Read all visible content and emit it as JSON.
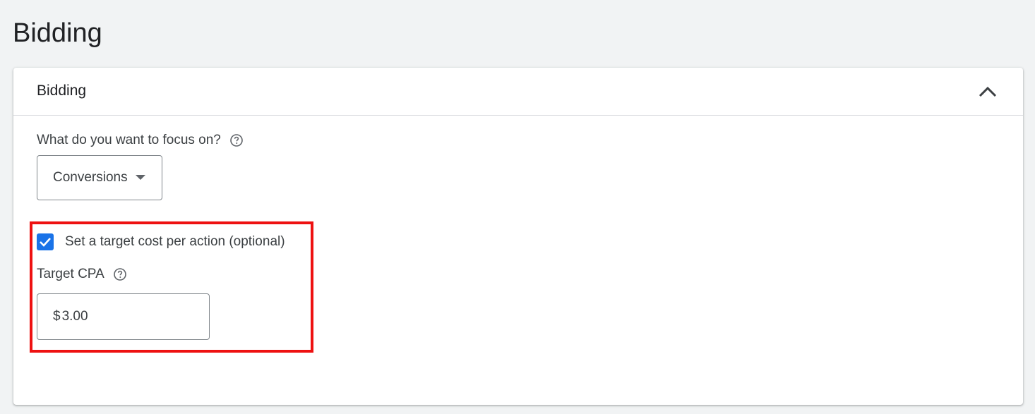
{
  "page": {
    "title": "Bidding"
  },
  "section": {
    "title": "Bidding",
    "collapse_icon": "chevron-up-icon"
  },
  "focus": {
    "label": "What do you want to focus on?",
    "help_icon": "help-circle-icon",
    "selected": "Conversions",
    "arrow_icon": "dropdown-arrow-icon"
  },
  "target_cpa": {
    "checkbox_label": "Set a target cost per action (optional)",
    "checked": true,
    "label": "Target CPA",
    "help_icon": "help-circle-icon",
    "currency": "$",
    "value": "3.00"
  },
  "colors": {
    "accent": "#1a73e8",
    "highlight": "#ee1111",
    "background": "#f1f3f4"
  }
}
